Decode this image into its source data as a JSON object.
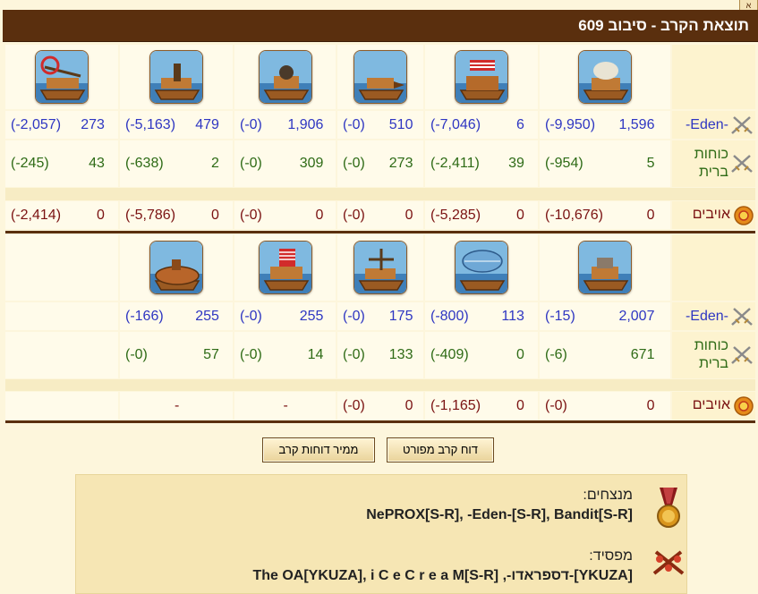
{
  "window": {
    "title": "תוצאת הקרב - סיבוב 609",
    "corner_tab": "א"
  },
  "labels": {
    "eden": "-Eden-",
    "allies": "כוחות ברית",
    "enemies": "אויבים"
  },
  "table1": {
    "units": [
      "unit-ship-catapult",
      "unit-ship-balloon",
      "unit-ship-ram",
      "unit-ship-cannon",
      "unit-ship-mortar",
      "unit-ship-ballista-heavy"
    ],
    "eden": [
      [
        "1,596",
        "(-9,950)"
      ],
      [
        "6",
        "(-7,046)"
      ],
      [
        "510",
        "(-0)"
      ],
      [
        "1,906",
        "(-0)"
      ],
      [
        "479",
        "(-5,163)"
      ],
      [
        "273",
        "(-2,057)"
      ]
    ],
    "allies": [
      [
        "5",
        "(-954)"
      ],
      [
        "39",
        "(-2,411)"
      ],
      [
        "273",
        "(-0)"
      ],
      [
        "309",
        "(-0)"
      ],
      [
        "2",
        "(-638)"
      ],
      [
        "43",
        "(-245)"
      ]
    ],
    "enemies": [
      [
        "0",
        "(-10,676)"
      ],
      [
        "0",
        "(-5,285)"
      ],
      [
        "0",
        "(-0)"
      ],
      [
        "0",
        "(-0)"
      ],
      [
        "0",
        "(-5,786)"
      ],
      [
        "0",
        "(-2,414)"
      ]
    ]
  },
  "table2": {
    "units": [
      "unit-ship-flamethrower",
      "unit-ship-gyrocopter",
      "unit-ship-ballista",
      "unit-ship-paddle",
      "unit-ship-submarine"
    ],
    "eden": [
      [
        "2,007",
        "(-15)"
      ],
      [
        "113",
        "(-800)"
      ],
      [
        "175",
        "(-0)"
      ],
      [
        "255",
        "(-0)"
      ],
      [
        "255",
        "(-166)"
      ]
    ],
    "allies": [
      [
        "671",
        "(-6)"
      ],
      [
        "0",
        "(-409)"
      ],
      [
        "133",
        "(-0)"
      ],
      [
        "14",
        "(-0)"
      ],
      [
        "57",
        "(-0)"
      ]
    ],
    "enemies": [
      [
        "0",
        "(-0)"
      ],
      [
        "0",
        "(-1,165)"
      ],
      [
        "0",
        "(-0)"
      ],
      [
        "-",
        ""
      ],
      [
        "-",
        ""
      ]
    ]
  },
  "buttons": {
    "detailed_report": "דוח קרב מפורט",
    "convert_reports": "ממיר דוחות קרב"
  },
  "summary": {
    "winners_label": "מנצחים:",
    "winners": "NePROX[S-R], -Eden-[S-R], Bandit[S-R]",
    "losers_label": "מפסיד:",
    "losers": "[YKUZA]-דספראדו-, The OA[YKUZA], i C e C r e a M[S-R]"
  },
  "colors": {
    "header_brown": "#5a2f0e",
    "own_blue": "#2e36c2",
    "ally_green": "#2e6b16",
    "enemy_red": "#7a1212",
    "background": "#fdf6dc"
  }
}
